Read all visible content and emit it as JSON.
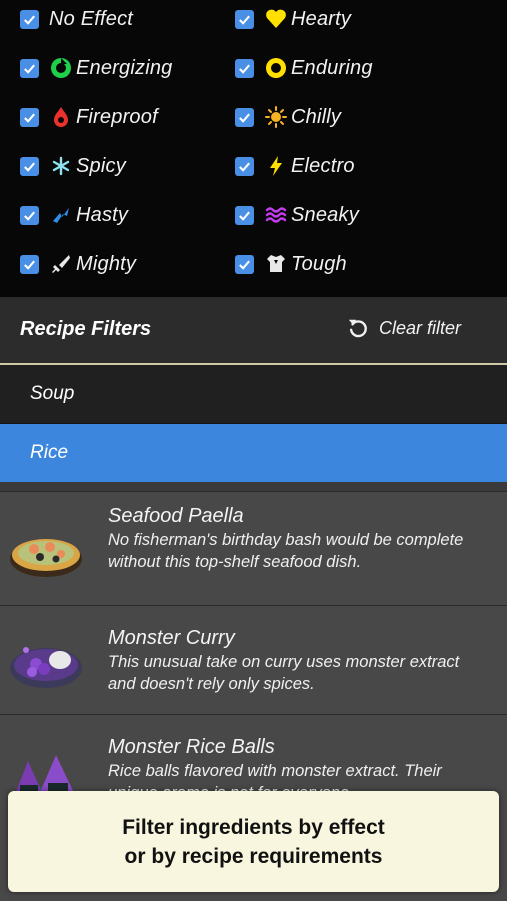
{
  "effects": [
    {
      "label": "No Effect",
      "icon": "none"
    },
    {
      "label": "Hearty",
      "icon": "heart-icon",
      "color": "#ffe000"
    },
    {
      "label": "Energizing",
      "icon": "energizing-icon",
      "color": "#1fd14a"
    },
    {
      "label": "Enduring",
      "icon": "enduring-icon",
      "color": "#ffe000"
    },
    {
      "label": "Fireproof",
      "icon": "fireproof-icon",
      "color": "#e8322b"
    },
    {
      "label": "Chilly",
      "icon": "chilly-icon",
      "color": "#f5b223"
    },
    {
      "label": "Spicy",
      "icon": "spicy-icon",
      "color": "#8fe3f0"
    },
    {
      "label": "Electro",
      "icon": "electro-icon",
      "color": "#ffe000"
    },
    {
      "label": "Hasty",
      "icon": "hasty-icon",
      "color": "#2f8fe8"
    },
    {
      "label": "Sneaky",
      "icon": "sneaky-icon",
      "color": "#c23cf0"
    },
    {
      "label": "Mighty",
      "icon": "mighty-icon",
      "color": "#e8e8e8"
    },
    {
      "label": "Tough",
      "icon": "tough-icon",
      "color": "#e8e8e8"
    }
  ],
  "filters": {
    "title": "Recipe Filters",
    "clear_label": "Clear filter"
  },
  "categories": [
    {
      "label": "Soup",
      "selected": false
    },
    {
      "label": "Rice",
      "selected": true
    }
  ],
  "recipes": [
    {
      "name": "Seafood Paella",
      "description": "No fisherman's birthday bash would be complete without this top-shelf seafood dish."
    },
    {
      "name": "Monster Curry",
      "description": "This unusual take on curry uses monster extract and doesn't rely only spices."
    },
    {
      "name": "Monster Rice Balls",
      "description": "Rice balls flavored with monster extract. Their unique aroma is not for everyone."
    }
  ],
  "tooltip": {
    "line1": "Filter ingredients by effect",
    "line2": "or by recipe requirements"
  },
  "colors": {
    "accent": "#3d86de",
    "checkbox": "#4a8fe6",
    "tooltip_bg": "#f8f6de"
  }
}
